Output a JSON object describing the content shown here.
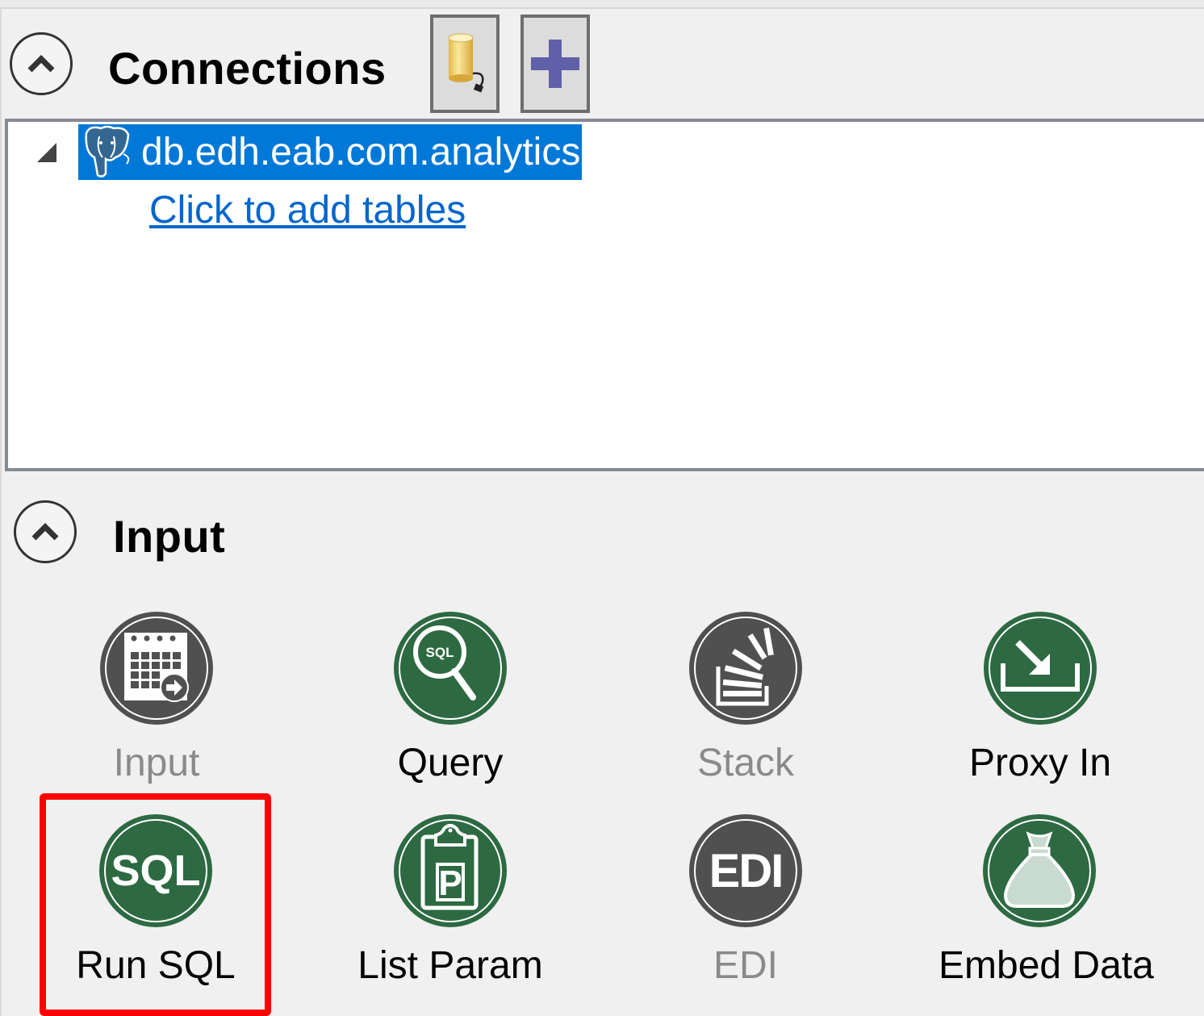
{
  "connections": {
    "title": "Connections",
    "toolbar": [
      {
        "name": "connect-database",
        "icon": "database-plug-icon"
      },
      {
        "name": "add-connection",
        "icon": "plus-icon",
        "color": "#6060a8"
      }
    ],
    "tree": {
      "items": [
        {
          "label": "db.edh.eab.com.analytics",
          "icon": "postgresql-elephant-icon",
          "selected": true,
          "expanded": true,
          "children_link": "Click to add tables"
        }
      ],
      "selection_color": "#0078d7",
      "link_color": "#0066cc"
    }
  },
  "input": {
    "title": "Input",
    "tools": [
      {
        "label": "Input",
        "icon": "calendar-arrow-icon",
        "enabled": false
      },
      {
        "label": "Query",
        "icon": "sql-magnifier-icon",
        "enabled": true
      },
      {
        "label": "Stack",
        "icon": "stack-icon",
        "enabled": false
      },
      {
        "label": "Proxy In",
        "icon": "proxy-in-icon",
        "enabled": true
      },
      {
        "label": "Run SQL",
        "icon": "sql-icon",
        "enabled": true,
        "highlighted": true
      },
      {
        "label": "List Param",
        "icon": "clipboard-p-icon",
        "enabled": true
      },
      {
        "label": "EDI",
        "icon": "edi-icon",
        "enabled": false
      },
      {
        "label": "Embed Data",
        "icon": "bag-icon",
        "enabled": true
      }
    ],
    "colors": {
      "enabled_icon": "#2d6a42",
      "disabled_icon": "#505050",
      "highlight": "#ff0000"
    }
  }
}
